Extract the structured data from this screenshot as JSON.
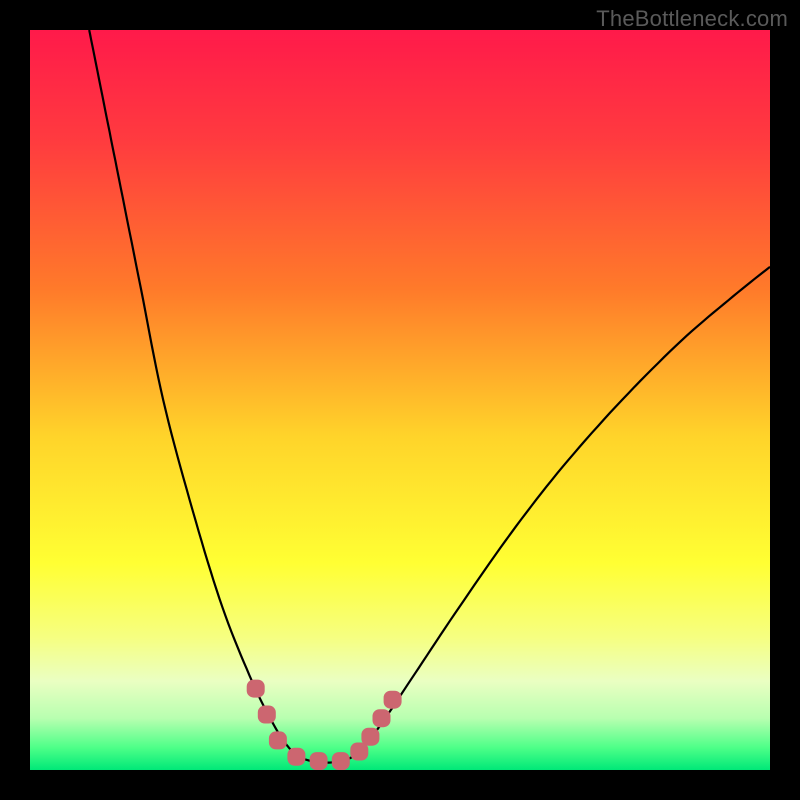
{
  "watermark": "TheBottleneck.com",
  "chart_data": {
    "type": "line",
    "title": "",
    "xlabel": "",
    "ylabel": "",
    "xlim": [
      0,
      100
    ],
    "ylim": [
      0,
      100
    ],
    "gradient_stops": [
      {
        "offset": 0,
        "color": "#ff1a4a"
      },
      {
        "offset": 15,
        "color": "#ff3b3f"
      },
      {
        "offset": 35,
        "color": "#ff7a2a"
      },
      {
        "offset": 55,
        "color": "#ffd42a"
      },
      {
        "offset": 72,
        "color": "#ffff33"
      },
      {
        "offset": 82,
        "color": "#f6ff80"
      },
      {
        "offset": 88,
        "color": "#eaffc2"
      },
      {
        "offset": 93,
        "color": "#b8ffb0"
      },
      {
        "offset": 97,
        "color": "#4dff88"
      },
      {
        "offset": 100,
        "color": "#00e878"
      }
    ],
    "series": [
      {
        "name": "bottleneck-curve",
        "stroke": "#000000",
        "points": [
          {
            "x": 8,
            "y": 100
          },
          {
            "x": 10,
            "y": 90
          },
          {
            "x": 12,
            "y": 80
          },
          {
            "x": 15,
            "y": 65
          },
          {
            "x": 18,
            "y": 50
          },
          {
            "x": 22,
            "y": 35
          },
          {
            "x": 26,
            "y": 22
          },
          {
            "x": 30,
            "y": 12
          },
          {
            "x": 33,
            "y": 6
          },
          {
            "x": 35,
            "y": 3
          },
          {
            "x": 37,
            "y": 1.5
          },
          {
            "x": 40,
            "y": 1
          },
          {
            "x": 43,
            "y": 1.5
          },
          {
            "x": 45,
            "y": 3
          },
          {
            "x": 48,
            "y": 7
          },
          {
            "x": 52,
            "y": 13
          },
          {
            "x": 58,
            "y": 22
          },
          {
            "x": 65,
            "y": 32
          },
          {
            "x": 72,
            "y": 41
          },
          {
            "x": 80,
            "y": 50
          },
          {
            "x": 88,
            "y": 58
          },
          {
            "x": 95,
            "y": 64
          },
          {
            "x": 100,
            "y": 68
          }
        ]
      }
    ],
    "markers": {
      "color": "#cc6670",
      "shape": "rounded-rect",
      "points": [
        {
          "x": 30.5,
          "y": 11
        },
        {
          "x": 32,
          "y": 7.5
        },
        {
          "x": 33.5,
          "y": 4
        },
        {
          "x": 36,
          "y": 1.8
        },
        {
          "x": 39,
          "y": 1.2
        },
        {
          "x": 42,
          "y": 1.2
        },
        {
          "x": 44.5,
          "y": 2.5
        },
        {
          "x": 46,
          "y": 4.5
        },
        {
          "x": 47.5,
          "y": 7
        },
        {
          "x": 49,
          "y": 9.5
        }
      ]
    }
  }
}
